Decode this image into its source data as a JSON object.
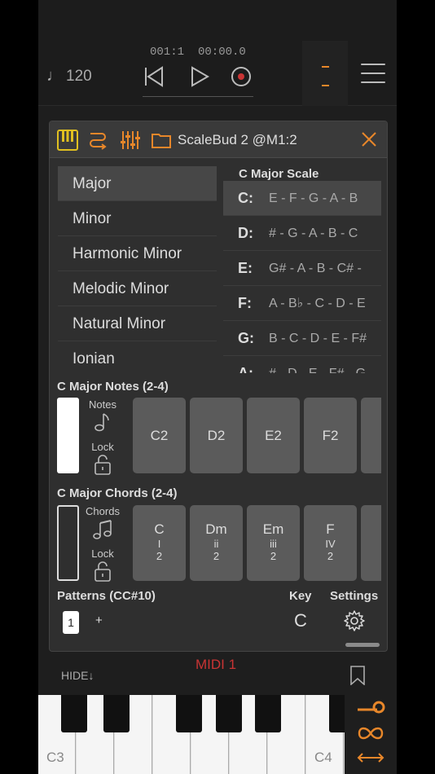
{
  "transport": {
    "tempo": "120",
    "position": "001:1",
    "time": "00:00.0",
    "meter_marks": "--"
  },
  "panel": {
    "title": "ScaleBud 2 @M1:2",
    "scales": [
      "Major",
      "Minor",
      "Harmonic Minor",
      "Melodic Minor",
      "Natural Minor",
      "Ionian"
    ],
    "selected_scale": "Major",
    "scale_heading": "C Major Scale",
    "keys": [
      {
        "key": "C:",
        "notes": "E - F - G - A - B"
      },
      {
        "key": "D:",
        "notes": "# - G - A - B - C"
      },
      {
        "key": "E:",
        "notes": "G# - A - B - C# -"
      },
      {
        "key": "F:",
        "notes": "A - B♭ - C - D - E"
      },
      {
        "key": "G:",
        "notes": "B - C - D - E - F#"
      },
      {
        "key": "A:",
        "notes": "# - D - E - F# - G"
      }
    ],
    "notes_section": {
      "title": "C Major Notes (2-4)",
      "notes_label": "Notes",
      "lock_label": "Lock",
      "cells": [
        "C2",
        "D2",
        "E2",
        "F2"
      ]
    },
    "chords_section": {
      "title": "C Major Chords (2-4)",
      "chords_label": "Chords",
      "lock_label": "Lock",
      "cells": [
        {
          "name": "C",
          "degree": "I",
          "octave": "2"
        },
        {
          "name": "Dm",
          "degree": "ii",
          "octave": "2"
        },
        {
          "name": "Em",
          "degree": "iii",
          "octave": "2"
        },
        {
          "name": "F",
          "degree": "IV",
          "octave": "2"
        }
      ]
    },
    "patterns_title": "Patterns (CC#10)",
    "pattern_selected": "1",
    "pattern_add": "+",
    "key_label": "Key",
    "key_value": "C",
    "settings_label": "Settings"
  },
  "bottom": {
    "hide_label": "HIDE↓",
    "midi_label": "MIDI 1"
  },
  "keyboard": {
    "left_label": "C3",
    "right_label": "C4"
  },
  "colors": {
    "accent": "#e8872a",
    "midi_red": "#c93434",
    "panel_bg": "#2f2f2f",
    "cell_bg": "#5b5b5b"
  }
}
